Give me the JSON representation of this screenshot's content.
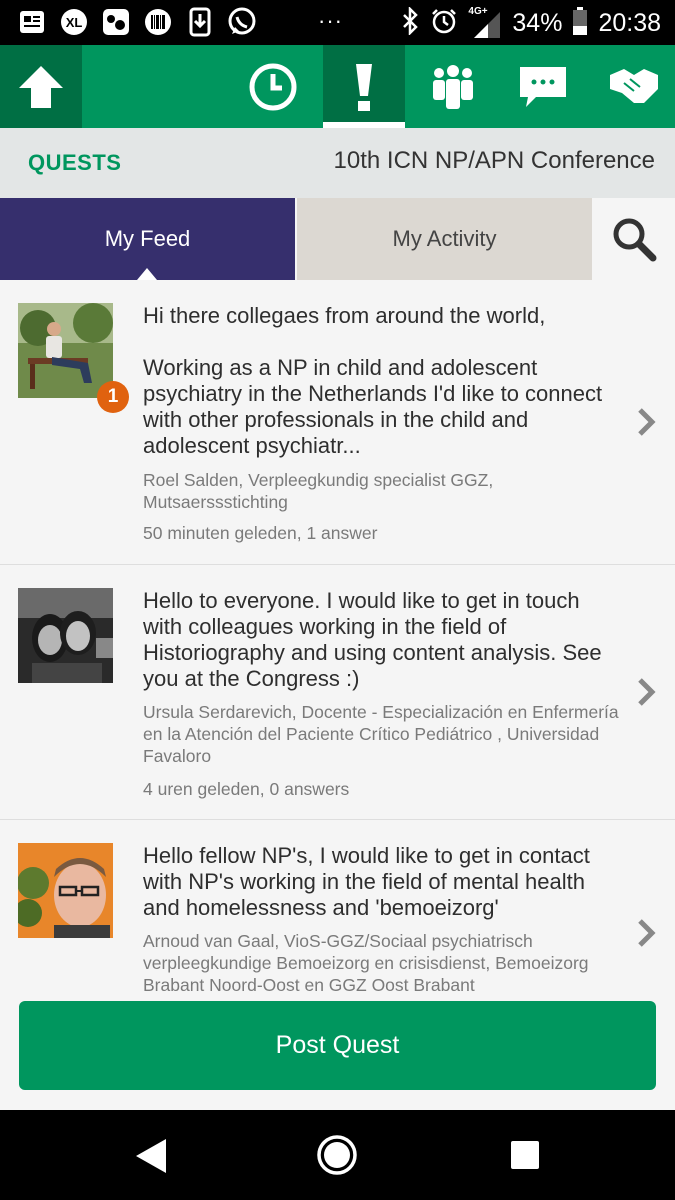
{
  "status_bar": {
    "left_icons": [
      "news-icon",
      "xl-icon",
      "game-icon",
      "barcode-icon",
      "download-icon",
      "whatsapp-icon"
    ],
    "overflow": "···",
    "network": "4G+",
    "battery": "34%",
    "time": "20:38"
  },
  "nav": {
    "items": [
      "home",
      "agenda",
      "quests",
      "attendees",
      "messages",
      "partners"
    ],
    "active": "quests"
  },
  "header": {
    "title": "QUESTS",
    "conference": "10th ICN NP/APN Conference"
  },
  "tabs": {
    "feed": "My Feed",
    "activity": "My Activity"
  },
  "feed": [
    {
      "message": "Hi there collegaes from around the world,\n\nWorking as a NP in child and adolescent psychiatry in the Netherlands I'd like to connect with  other  professionals in the child and adolescent psychiatr...",
      "author": "Roel Salden, Verpleegkundig specialist GGZ, Mutsaerssstichting",
      "meta": "50 minuten geleden, 1 answer",
      "badge": "1"
    },
    {
      "message": "Hello to everyone. I would like to get in touch with colleagues working in the field of Historiography and using content analysis. See you at the Congress :)",
      "author": "Ursula Serdarevich, Docente - Especialización en Enfermería en la Atención del Paciente Crítico Pediátrico , Universidad Favaloro",
      "meta": "4 uren geleden, 0 answers"
    },
    {
      "message": "Hello fellow NP's, I would like to get in contact with NP's working in the field of mental health and homelessness and 'bemoeizorg'",
      "author": "Arnoud van Gaal, VioS-GGZ/Sociaal psychiatrisch verpleegkundige Bemoeizorg en crisisdienst, Bemoeizorg Brabant Noord-Oost en GGZ Oost Brabant",
      "meta": ""
    }
  ],
  "post_button": "Post Quest",
  "colors": {
    "brand_green": "#00965e",
    "dark_green": "#006f44",
    "tab_active": "#362f6d",
    "badge": "#e0620f"
  }
}
